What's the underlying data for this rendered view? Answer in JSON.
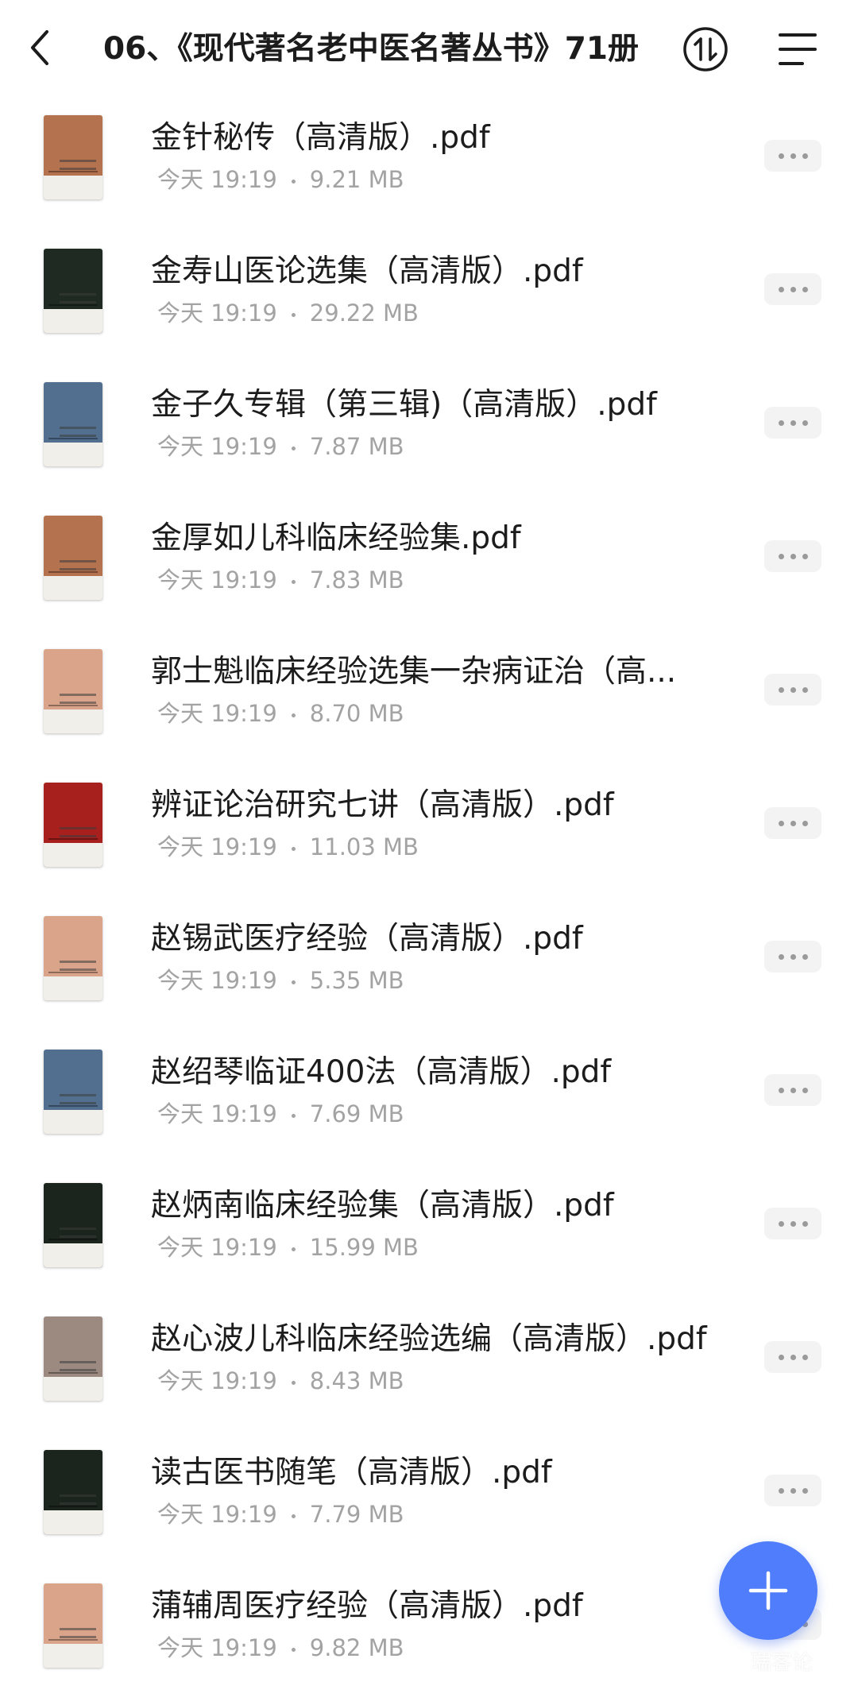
{
  "header": {
    "title": "06、《现代著名老中医名著丛书》71册",
    "back_icon": "chevron-left-icon",
    "sort_icon": "sort-arrows-icon",
    "menu_icon": "menu-lines-icon"
  },
  "files": [
    {
      "name": "金针秘传（高清版）.pdf",
      "date": "今天 19:19",
      "size": "9.21 MB",
      "cover_color": "#b5724e"
    },
    {
      "name": "金寿山医论选集（高清版）.pdf",
      "date": "今天 19:19",
      "size": "29.22 MB",
      "cover_color": "#1f2b22"
    },
    {
      "name": "金子久专辑（第三辑)（高清版）.pdf",
      "date": "今天 19:19",
      "size": "7.87 MB",
      "cover_color": "#536f8f"
    },
    {
      "name": "金厚如儿科临床经验集.pdf",
      "date": "今天 19:19",
      "size": "7.83 MB",
      "cover_color": "#b5724e"
    },
    {
      "name": "郭士魁临床经验选集一杂病证治（高...",
      "date": "今天 19:19",
      "size": "8.70 MB",
      "cover_color": "#d9a48a"
    },
    {
      "name": "辨证论治研究七讲（高清版）.pdf",
      "date": "今天 19:19",
      "size": "11.03 MB",
      "cover_color": "#a8201e"
    },
    {
      "name": "赵锡武医疗经验（高清版）.pdf",
      "date": "今天 19:19",
      "size": "5.35 MB",
      "cover_color": "#d9a48a"
    },
    {
      "name": "赵绍琴临证400法（高清版）.pdf",
      "date": "今天 19:19",
      "size": "7.69 MB",
      "cover_color": "#536f8f"
    },
    {
      "name": "赵炳南临床经验集（高清版）.pdf",
      "date": "今天 19:19",
      "size": "15.99 MB",
      "cover_color": "#1c241e"
    },
    {
      "name": "赵心波儿科临床经验选编（高清版）.pdf",
      "date": "今天 19:19",
      "size": "8.43 MB",
      "cover_color": "#9c8a80"
    },
    {
      "name": "读古医书随笔（高清版）.pdf",
      "date": "今天 19:19",
      "size": "7.79 MB",
      "cover_color": "#1c241e"
    },
    {
      "name": "蒲辅周医疗经验（高清版）.pdf",
      "date": "今天 19:19",
      "size": "9.82 MB",
      "cover_color": "#d9a48a"
    }
  ],
  "more_icon": "more-dots-icon",
  "fab": {
    "icon": "plus-icon",
    "color": "#4f7dfb"
  },
  "watermark": "瑞客论"
}
